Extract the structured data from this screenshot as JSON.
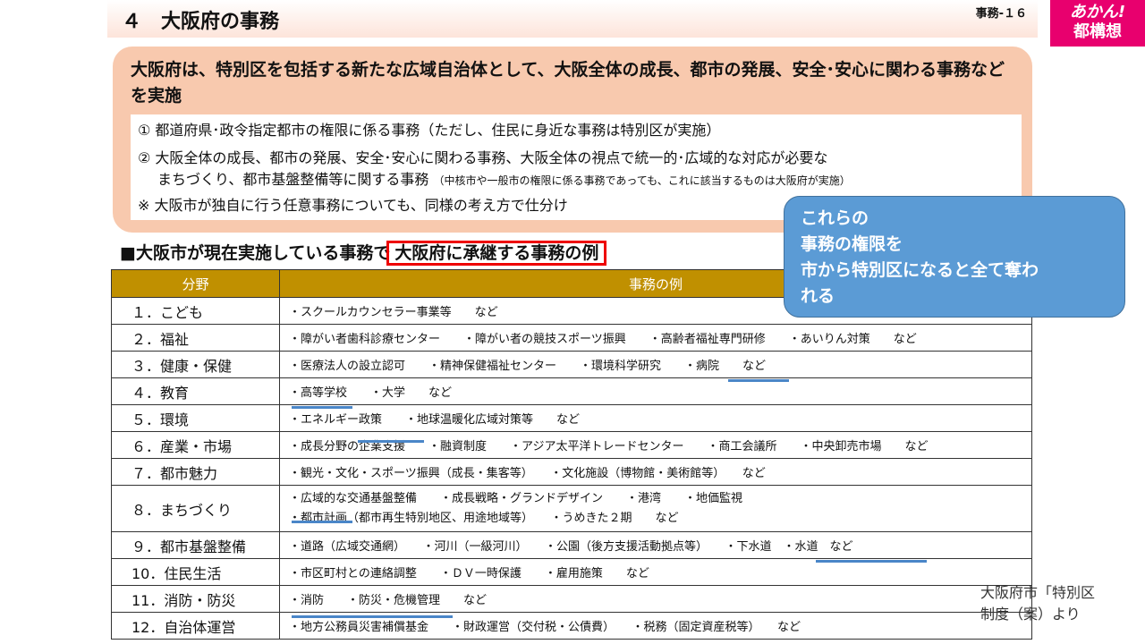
{
  "header": {
    "title": "４　大阪府の事務",
    "page": "事務-１６"
  },
  "logo": {
    "line1": "あかん!",
    "line2": "都構想",
    "color": "#e8006e"
  },
  "summary": {
    "lead": "大阪府は、特別区を包括する新たな広域自治体として、大阪全体の成長、都市の発展、安全･安心に関わる事務などを実施",
    "item1": "①  都道府県･政令指定都市の権限に係る事務（ただし、住民に身近な事務は特別区が実施）",
    "item2_line1": "②  大阪全体の成長、都市の発展、安全･安心に関わる事務、大阪全体の視点で統一的･広域的な対応が必要な",
    "item2_line2": "まちづくり、都市基盤整備等に関する事務",
    "item2_note": "（中核市や一般市の権限に係る事務であっても、これに該当するものは大阪府が実施）",
    "item3": "※ 大阪市が独自に行う任意事務についても、同様の考え方で仕分け"
  },
  "callout": {
    "line1": "これらの",
    "line2": "事務の権限を",
    "line3": "市から特別区になると全て奪わ",
    "line4": "れる"
  },
  "section": {
    "prefix": "■大阪市が現在実施している事務で",
    "highlight": "大阪府に承継する事務の例"
  },
  "table": {
    "headers": [
      "分野",
      "事務の例"
    ],
    "rows": [
      {
        "category": "１．こども",
        "examples": [
          "・スクールカウンセラー事業等　　など"
        ]
      },
      {
        "category": "２．福祉",
        "examples": [
          "・障がい者歯科診療センター　　・障がい者の競技スポーツ振興　　・高齢者福祉専門研修　　・あいりん対策　　など"
        ]
      },
      {
        "category": "３．健康・保健",
        "examples": [
          "・医療法人の設立認可　　・精神保健福祉センター　　・環境科学研究　　・病院　　など"
        ]
      },
      {
        "category": "４．教育",
        "examples": [
          "・高等学校　　・大学　　など"
        ]
      },
      {
        "category": "５．環境",
        "examples": [
          "・エネルギー政策　　・地球温暖化広域対策等　　など"
        ]
      },
      {
        "category": "６．産業・市場",
        "examples": [
          "・成長分野の企業支援　　・融資制度　　・アジア太平洋トレードセンター　　・商工会議所　　・中央卸売市場　　など"
        ]
      },
      {
        "category": "７．都市魅力",
        "examples": [
          "・観光・文化・スポーツ振興（成長・集客等）　　・文化施設（博物館・美術館等）　　など"
        ]
      },
      {
        "category": "８．まちづくり",
        "examples": [
          "・広域的な交通基盤整備　　・成長戦略・グランドデザイン　　・港湾　　・地価監視",
          "・都市計画（都市再生特別地区、用途地域等）　　・うめきた２期　　など"
        ]
      },
      {
        "category": "９．都市基盤整備",
        "examples": [
          "・道路（広域交通網）　　・河川（一級河川）　　・公園（後方支援活動拠点等）　　・下水道　・水道　など"
        ]
      },
      {
        "category": "10．住民生活",
        "examples": [
          "・市区町村との連絡調整　　・ＤＶ一時保護　　・雇用施策　　など"
        ]
      },
      {
        "category": "11．消防・防災",
        "examples": [
          "・消防　　・防災・危機管理　　など"
        ]
      },
      {
        "category": "12．自治体運営",
        "examples": [
          "・地方公務員災害補償基金　　・財政運営（交付税・公債費）　　・税務（固定資産税等）　　など"
        ]
      }
    ]
  },
  "source_note": {
    "line1": "大阪府市「特別区",
    "line2": "制度（案）より"
  },
  "colors": {
    "header_fill": "#c09000",
    "summary_fill": "#f8c9ae",
    "callout_fill": "#5b9bd5",
    "highlight_border": "#ee0000",
    "underline_marks": "#4a86c8"
  }
}
